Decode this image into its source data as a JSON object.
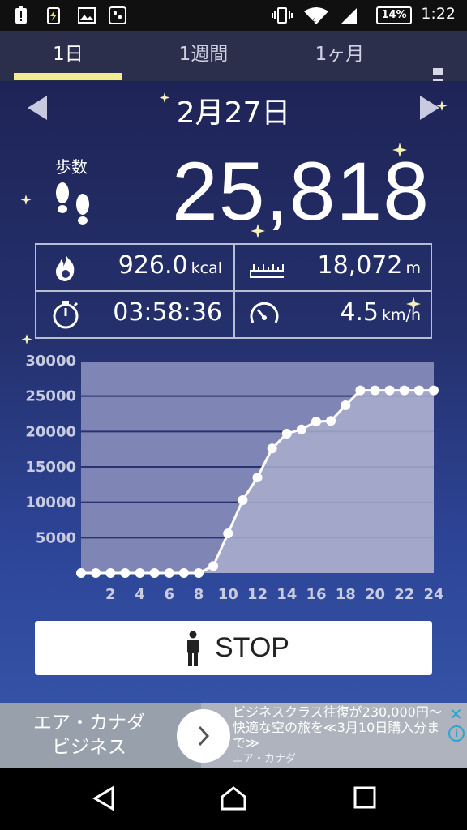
{
  "status_bar": {
    "battery": "14%",
    "time": "1:22"
  },
  "tabs": [
    {
      "label": "1日",
      "active": true
    },
    {
      "label": "1週間",
      "active": false
    },
    {
      "label": "1ヶ月",
      "active": false
    }
  ],
  "date": "2月27日",
  "steps": {
    "label": "歩数",
    "value": "25,818"
  },
  "stats": {
    "calories": {
      "value": "926.0",
      "unit": "kcal",
      "icon": "flame-icon"
    },
    "distance": {
      "value": "18,072",
      "unit": "m",
      "icon": "ruler-icon"
    },
    "duration": {
      "value": "03:58:36",
      "icon": "stopwatch-icon"
    },
    "speed": {
      "value": "4.5",
      "unit": "km/h",
      "icon": "speedometer-icon"
    }
  },
  "chart_data": {
    "type": "line",
    "x": [
      0,
      1,
      2,
      3,
      4,
      5,
      6,
      7,
      8,
      9,
      10,
      11,
      12,
      13,
      14,
      15,
      16,
      17,
      18,
      19,
      20,
      21,
      22,
      23,
      24
    ],
    "values": [
      0,
      0,
      0,
      0,
      0,
      0,
      0,
      0,
      0,
      1000,
      5600,
      10300,
      13500,
      17600,
      19700,
      20300,
      21400,
      21500,
      23700,
      25800,
      25800,
      25800,
      25800,
      25800,
      25800
    ],
    "ylim": [
      0,
      30000
    ],
    "y_ticks": [
      "30000",
      "25000",
      "20000",
      "15000",
      "10000",
      "5000"
    ],
    "x_ticks": [
      "2",
      "4",
      "6",
      "8",
      "10",
      "12",
      "14",
      "16",
      "18",
      "20",
      "22",
      "24"
    ],
    "grid": true
  },
  "stop_button": {
    "label": "STOP"
  },
  "ad": {
    "title_line1": "エア・カナダ",
    "title_line2": "ビジネス",
    "text": "ビジネスクラス往復が230,000円〜 快適な空の旅を≪3月10日購入分まで≫",
    "source": "エア・カナダ",
    "close": "✕",
    "info": "i"
  }
}
